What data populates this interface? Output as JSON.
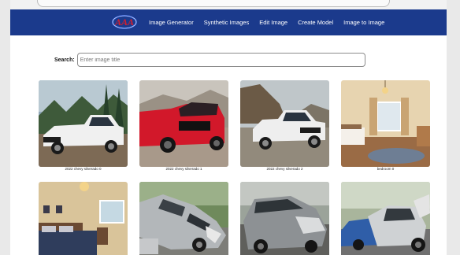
{
  "navbar": {
    "logo_text": "AAA",
    "links": [
      "Image Generator",
      "Synthetic Images",
      "Edit Image",
      "Create Model",
      "Image to Image"
    ]
  },
  "search": {
    "label": "Search:",
    "placeholder": "Enter image title",
    "value": ""
  },
  "images": [
    {
      "caption": "2022 chevy silverado 0",
      "icon": "white-pickup-truck"
    },
    {
      "caption": "2022 chevy silverado 1",
      "icon": "red-pickup-truck"
    },
    {
      "caption": "2022 chevy silverado 2",
      "icon": "white-pickup-truck"
    },
    {
      "caption": "bedroom 0",
      "icon": "bedroom-photo"
    },
    {
      "caption": "",
      "icon": "bedroom-photo"
    },
    {
      "caption": "",
      "icon": "crashed-car-photo"
    },
    {
      "caption": "",
      "icon": "crashed-car-photo"
    },
    {
      "caption": "",
      "icon": "crashed-car-photo"
    }
  ],
  "colors": {
    "navbar": "#1b3a8c",
    "logo_red": "#d3202f"
  }
}
